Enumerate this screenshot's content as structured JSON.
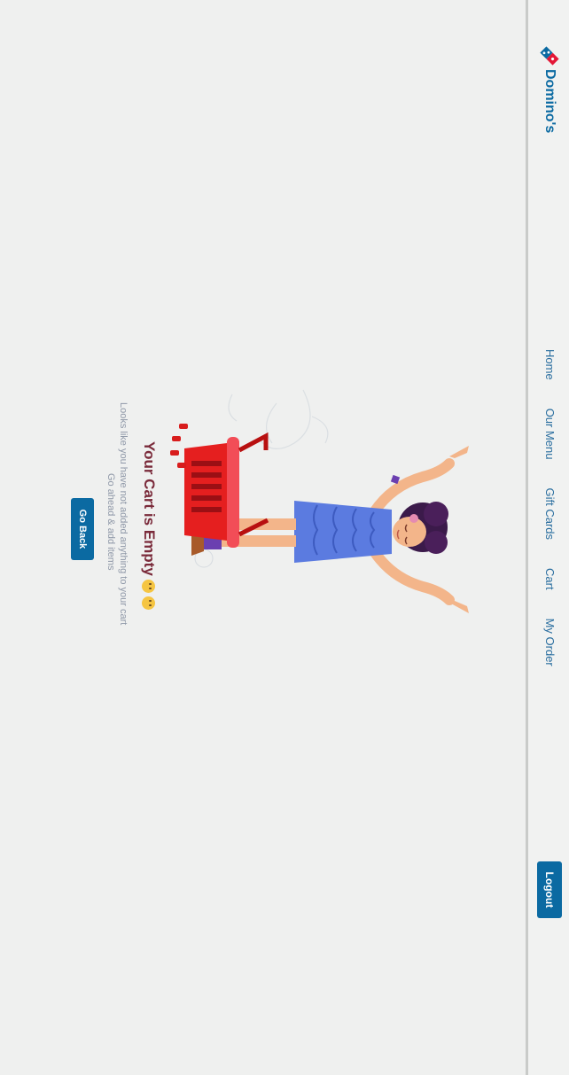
{
  "brand": {
    "name": "Domino's",
    "logo_icon": "dominos-tile-icon",
    "colors": {
      "blue": "#0b6aa2",
      "red": "#e31837"
    }
  },
  "nav": {
    "items": [
      {
        "label": "Home"
      },
      {
        "label": "Our Menu"
      },
      {
        "label": "Gift Cards"
      },
      {
        "label": "Cart"
      },
      {
        "label": "My Order"
      }
    ],
    "logout_label": "Logout"
  },
  "empty_cart": {
    "title": "Your Cart is Empty",
    "subtitle_line1": "Looks like you have not added anything to your cart",
    "subtitle_line2": "Go ahead & add items",
    "button_label": "Go Back",
    "emoji_icons": [
      "sad-face-icon",
      "sad-face-icon"
    ],
    "illustration_icon": "woman-with-cart-illustration"
  }
}
